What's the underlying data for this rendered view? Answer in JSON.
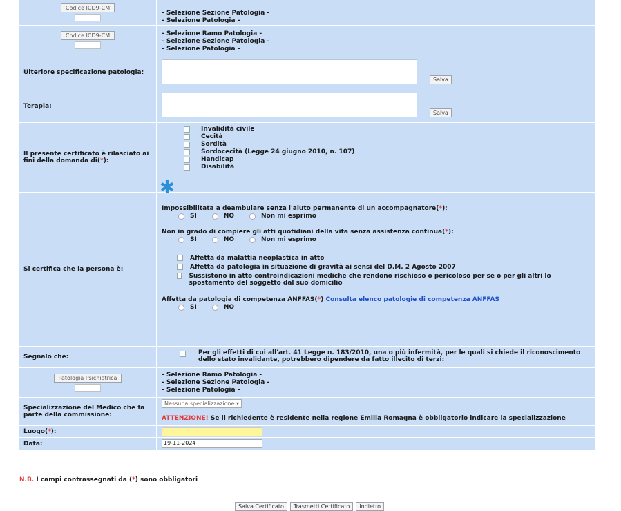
{
  "rows": {
    "icd_top": {
      "button": "Codice ICD9-CM",
      "lines": [
        "- Selezione Sezione Patologia -",
        "- Selezione Patologia -"
      ]
    },
    "icd2": {
      "button": "Codice ICD9-CM",
      "lines": [
        "- Selezione Ramo Patologia -",
        "- Selezione Sezione Patologia -",
        "- Selezione Patologia -"
      ]
    },
    "ulteriore": {
      "label": "Ulteriore specificazione patologia:",
      "salva": "Salva"
    },
    "terapia": {
      "label": "Terapia:",
      "salva": "Salva"
    },
    "domanda": {
      "label": "Il presente certificato è rilasciato ai fini della domanda di(",
      "req": "*",
      "label_end": "):",
      "options": [
        "Invalidità civile",
        "Cecità",
        "Sordità",
        "Sordocecità (Legge 24 giugno 2010, n. 107)",
        "Handicap",
        "Disabilità"
      ]
    },
    "certifica": {
      "label": "Si certifica che la persona è:",
      "q1": "Impossibilitata a deambulare senza l'aiuto permanente di un accompagnatore(",
      "q2": "Non in grado di compiere gli atti quotidiani della vita senza assistenza continua(",
      "yn": [
        "SI",
        "NO",
        "Non mi esprimo"
      ],
      "checks": [
        "Affetta da malattia neoplastica in atto",
        "Affetta da patologia in situazione di gravità ai sensi del D.M. 2 Agosto 2007",
        "Sussistono in atto controindicazioni mediche che rendono rischioso o pericoloso per se o per gli altri lo spostamento del soggetto dal suo domicilio"
      ],
      "anffas": "Affetta da patologia di competenza ANFFAS(",
      "anffas_link": "Consulta elenco patologie di competenza ANFFAS",
      "anffas_yn": [
        "SI",
        "NO"
      ]
    },
    "segnala": {
      "label": "Segnalo che:",
      "text": "Per gli effetti di cui all'art. 41 Legge n. 183/2010, una o più infermità, per le quali si chiede il riconoscimento dello stato invalidante, potrebbero dipendere da fatto illecito di terzi:"
    },
    "psichiatrica": {
      "button": "Patologia Psichiatrica",
      "lines": [
        "- Selezione Ramo Patologia -",
        "- Selezione Sezione Patologia -",
        "- Selezione Patologia -"
      ]
    },
    "specializzazione": {
      "label": "Specializzazione del Medico che fa parte della commissione:",
      "select": "Nessuna specializzazione",
      "attenzione": "ATTENZIONE!",
      "warn": " Se il richiedente è residente nella regione Emilia Romagna è obbligatorio indicare la specializzazione"
    },
    "luogo": {
      "label": "Luogo(",
      "req": "*",
      "end": "):"
    },
    "data": {
      "label": "Data:",
      "value": "19-11-2024"
    }
  },
  "note": {
    "nb": "N.B.",
    "text": " I campi contrassegnati da (",
    "req": "*",
    "end": ") sono obbligatori"
  },
  "footer": {
    "save": "Salva Certificato",
    "send": "Trasmetti Certificato",
    "back": "Indietro"
  }
}
